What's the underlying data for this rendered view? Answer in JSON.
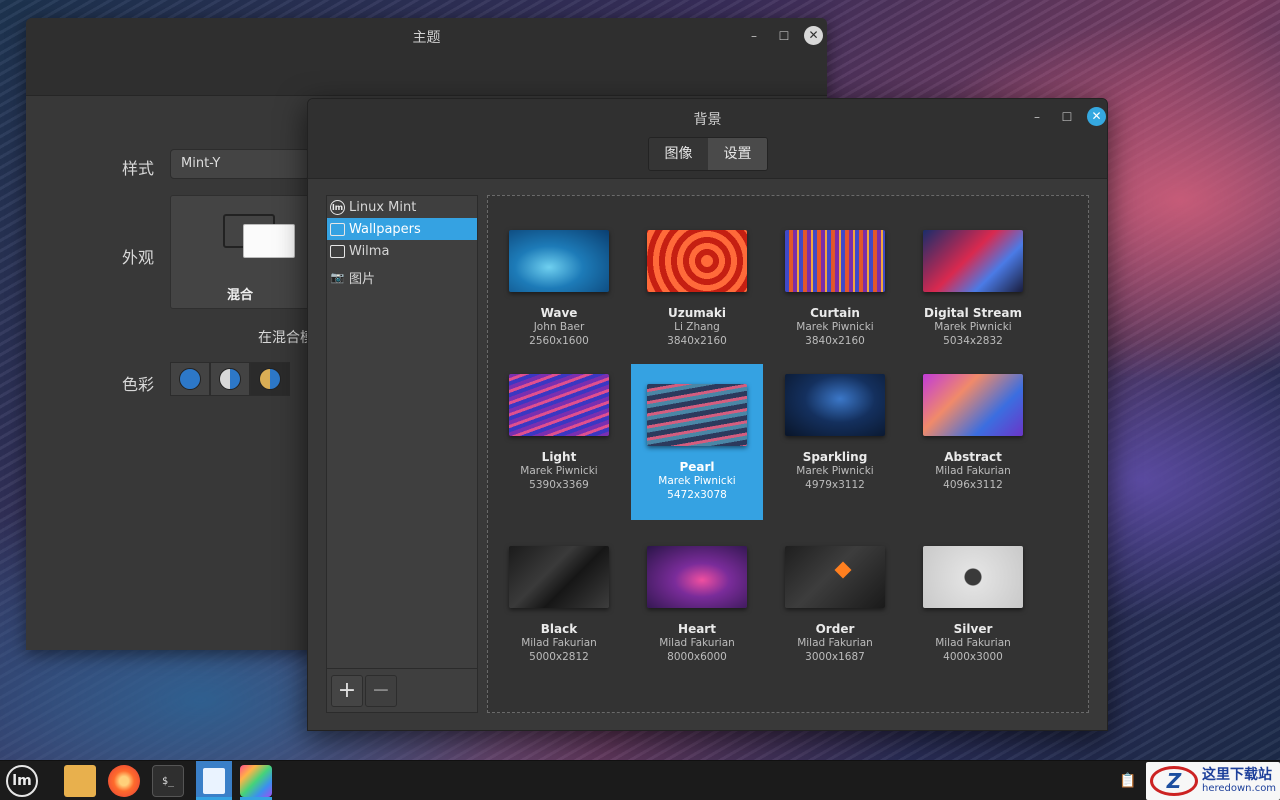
{
  "theme_window": {
    "title": "主题",
    "labels": {
      "style": "样式",
      "appearance": "外观",
      "color": "色彩"
    },
    "style_value": "Mint-Y",
    "appearance_option": "混合",
    "hint": "在混合模"
  },
  "bg_window": {
    "title": "背景",
    "tabs": [
      "图像",
      "设置"
    ],
    "active_tab": 1,
    "sidebar": [
      {
        "label": "Linux Mint",
        "icon": "mint-icon"
      },
      {
        "label": "Wallpapers",
        "icon": "monitor-icon",
        "selected": true
      },
      {
        "label": "Wilma",
        "icon": "monitor-icon"
      },
      {
        "label": "图片",
        "icon": "camera-icon"
      }
    ],
    "add_label": "+",
    "remove_label": "−",
    "wallpapers": [
      {
        "name": "Wave",
        "author": "John Baer",
        "res": "2560x1600",
        "thumb": "t-wave"
      },
      {
        "name": "Uzumaki",
        "author": "Li Zhang",
        "res": "3840x2160",
        "thumb": "t-uzumaki"
      },
      {
        "name": "Curtain",
        "author": "Marek Piwnicki",
        "res": "3840x2160",
        "thumb": "t-curtain"
      },
      {
        "name": "Digital Stream",
        "author": "Marek Piwnicki",
        "res": "5034x2832",
        "thumb": "t-digital"
      },
      {
        "name": "Light",
        "author": "Marek Piwnicki",
        "res": "5390x3369",
        "thumb": "t-light"
      },
      {
        "name": "Pearl",
        "author": "Marek Piwnicki",
        "res": "5472x3078",
        "thumb": "t-pearl",
        "selected": true
      },
      {
        "name": "Sparkling",
        "author": "Marek Piwnicki",
        "res": "4979x3112",
        "thumb": "t-sparkling"
      },
      {
        "name": "Abstract",
        "author": "Milad Fakurian",
        "res": "4096x3112",
        "thumb": "t-abstract"
      },
      {
        "name": "Black",
        "author": "Milad Fakurian",
        "res": "5000x2812",
        "thumb": "t-black"
      },
      {
        "name": "Heart",
        "author": "Milad Fakurian",
        "res": "8000x6000",
        "thumb": "t-heart"
      },
      {
        "name": "Order",
        "author": "Milad Fakurian",
        "res": "3000x1687",
        "thumb": "t-order"
      },
      {
        "name": "Silver",
        "author": "Milad Fakurian",
        "res": "4000x3000",
        "thumb": "t-silver"
      }
    ]
  },
  "taskbar": {
    "apps": [
      "menu-icon",
      "folder-icon",
      "firefox-icon",
      "terminal-icon",
      "files-icon",
      "paint-icon"
    ],
    "terminal_glyph": "$_"
  },
  "watermark": {
    "logo": "Z",
    "main": "这里下载站",
    "sub": "heredown.com"
  },
  "colors": {
    "accent": "#35a2e2",
    "window_bg": "#393939"
  }
}
